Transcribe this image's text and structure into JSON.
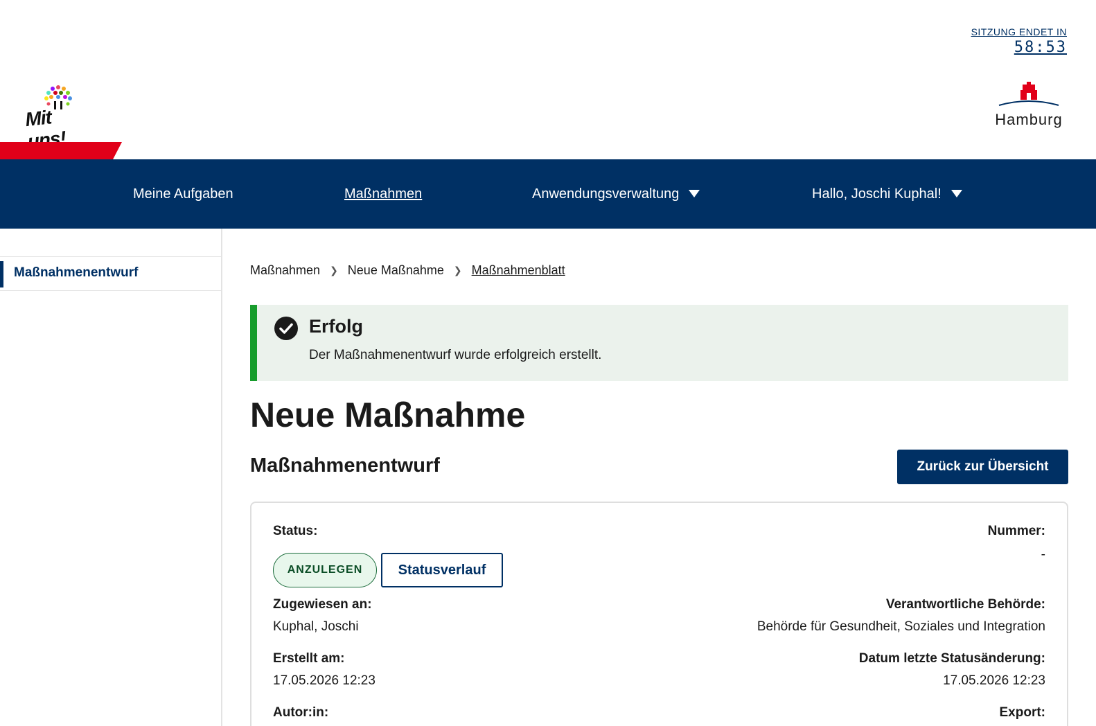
{
  "header": {
    "logo_text": "Mit uns!",
    "session_label": "SITZUNG ENDET IN",
    "session_time": "58:53",
    "city_name": "Hamburg"
  },
  "nav": {
    "items": [
      {
        "label": "Meine Aufgaben"
      },
      {
        "label": "Maßnahmen"
      },
      {
        "label": "Anwendungsverwaltung"
      },
      {
        "label": "Hallo, Joschi Kuphal!"
      }
    ]
  },
  "sidebar": {
    "items": [
      {
        "label": "Maßnahmenentwurf"
      }
    ]
  },
  "breadcrumb": {
    "items": [
      "Maßnahmen",
      "Neue Maßnahme",
      "Maßnahmenblatt"
    ]
  },
  "alert": {
    "title": "Erfolg",
    "message": "Der Maßnahmenentwurf wurde erfolgreich erstellt."
  },
  "page": {
    "title": "Neue Maßnahme",
    "subtitle": "Maßnahmenentwurf",
    "back_button": "Zurück zur Übersicht"
  },
  "details": {
    "status_label": "Status:",
    "status_value": "ANZULEGEN",
    "status_history_button": "Statusverlauf",
    "number_label": "Nummer:",
    "number_value": "-",
    "assigned_label": "Zugewiesen an:",
    "assigned_value": "Kuphal, Joschi",
    "authority_label": "Verantwortliche Behörde:",
    "authority_value": "Behörde für Gesundheit, Soziales und Integration",
    "created_label": "Erstellt am:",
    "created_value": "17.05.2026 12:23",
    "last_status_label": "Datum letzte Statusänderung:",
    "last_status_value": "17.05.2026 12:23",
    "author_label": "Autor:in:",
    "export_label": "Export:"
  },
  "colors": {
    "primary": "#003064",
    "accent_red": "#e10019",
    "success": "#179c2c",
    "success_bg": "#ebf2ec"
  }
}
